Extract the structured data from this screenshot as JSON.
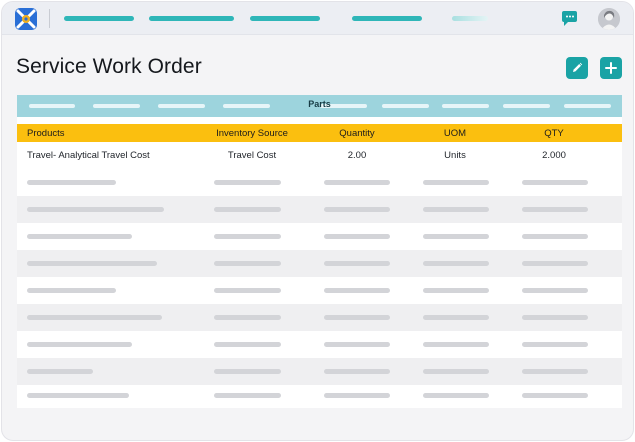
{
  "app": {
    "page_title": "Service Work Order",
    "accent_color": "#1aa3a5",
    "header_color": "#fbbf0f"
  },
  "parts": {
    "section_label": "Parts",
    "columns": [
      "Products",
      "Inventory Source",
      "Quantity",
      "UOM",
      "QTY"
    ],
    "rows": [
      {
        "product": "Travel- Analytical Travel Cost",
        "inventory_source": "Travel Cost",
        "quantity": "2.00",
        "uom": "Units",
        "qty": "2.000"
      }
    ]
  },
  "icons": {
    "logo": "app-logo-icon",
    "chat": "chat-icon",
    "avatar": "user-avatar",
    "edit": "pencil-icon",
    "add": "plus-icon"
  }
}
